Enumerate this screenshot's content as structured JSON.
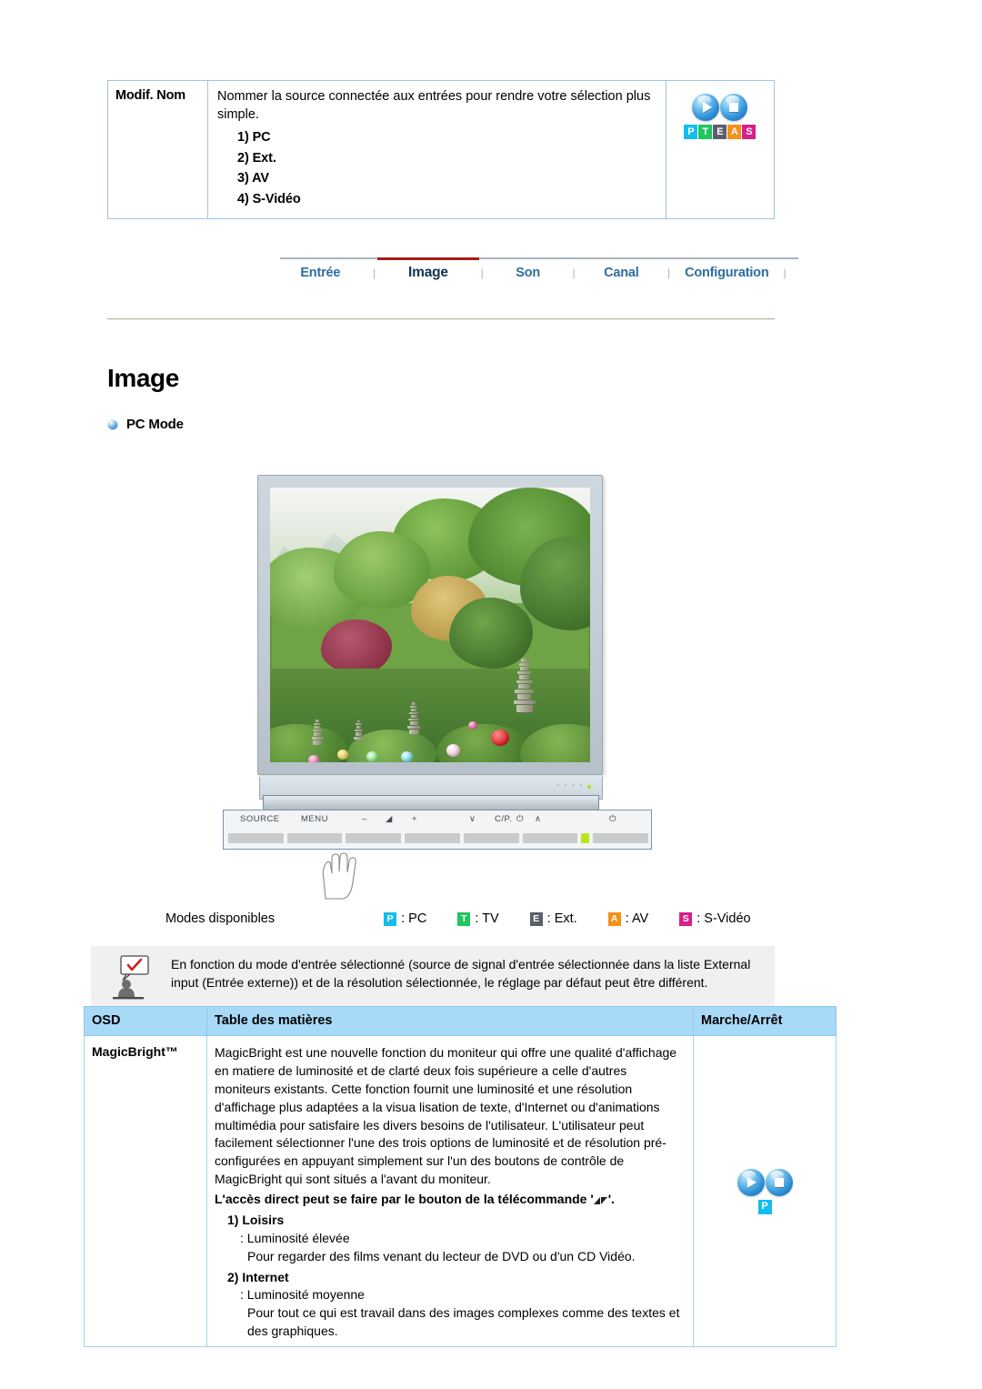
{
  "modif_table": {
    "label": "Modif. Nom",
    "description": "Nommer la source connectée aux entrées pour rendre votre sélection plus simple.",
    "options": [
      "1) PC",
      "2) Ext.",
      "3) AV",
      "4) S-Vidéo"
    ],
    "icon_badges": [
      {
        "letter": "P",
        "color": "#15bdee"
      },
      {
        "letter": "T",
        "color": "#22c55e"
      },
      {
        "letter": "E",
        "color": "#5b5f6b"
      },
      {
        "letter": "A",
        "color": "#f59019"
      },
      {
        "letter": "S",
        "color": "#d6208a"
      }
    ]
  },
  "nav": {
    "items": [
      {
        "label": "Entrée",
        "active": false
      },
      {
        "label": "Image",
        "active": true
      },
      {
        "label": "Son",
        "active": false
      },
      {
        "label": "Canal",
        "active": false
      },
      {
        "label": "Configuration",
        "active": false
      }
    ],
    "separator": "|",
    "active_color": "#12344f",
    "inactive_color": "#2d6e9e",
    "active_bar_color": "#a81b1b"
  },
  "page": {
    "title": "Image",
    "section_bullet": "PC Mode"
  },
  "monitor": {
    "controls": [
      {
        "label": "SOURCE"
      },
      {
        "label": "MENU"
      },
      {
        "label": "–"
      },
      {
        "label": "volume-icon"
      },
      {
        "label": "+"
      },
      {
        "label": "∨"
      },
      {
        "label": "C/P.⏻"
      },
      {
        "label": "∧"
      },
      {
        "label": "power-icon"
      }
    ],
    "control_labels": [
      "SOURCE",
      "MENU",
      "–",
      "+",
      "∨",
      "C/P.",
      "∧"
    ],
    "led_color": "#b8e61e"
  },
  "modes": {
    "label": "Modes disponibles",
    "items": [
      {
        "letter": "P",
        "color": "#15bdee",
        "text": ": PC"
      },
      {
        "letter": "T",
        "color": "#22c55e",
        "text": ": TV"
      },
      {
        "letter": "E",
        "color": "#5b5f6b",
        "text": ": Ext."
      },
      {
        "letter": "A",
        "color": "#f59019",
        "text": ": AV"
      },
      {
        "letter": "S",
        "color": "#d6208a",
        "text": ": S-Vidéo"
      }
    ]
  },
  "note": {
    "text": "En fonction du mode d'entrée sélectionné (source de signal d'entrée sélectionnée dans la liste External input (Entrée externe)) et de la résolution sélectionnée, le réglage par défaut peut être différent.",
    "background": "#f0f0f0"
  },
  "osd_table": {
    "headers": [
      "OSD",
      "Table des matières",
      "Marche/Arrêt"
    ],
    "header_bg": "#a8daf7",
    "border_color": "#9fd3ef",
    "rows": [
      {
        "osd": "MagicBright™",
        "paragraph": "MagicBright est une nouvelle fonction du moniteur qui offre une qualité d'affichage en matiere de luminosité et de clarté deux fois supérieure a celle d'autres moniteurs existants. Cette fonction fournit une luminosité et une résolution d'affichage plus adaptées a la visua lisation de texte, d'Internet ou d'animations multimédia pour satisfaire les divers besoins de l'utilisateur. L'utilisateur peut facilement sélectionner l'une des trois options de luminosité et de résolution pré-configurées en appuyant simplement sur l'un des boutons de contrôle de MagicBright qui sont situés a l'avant du moniteur.",
        "access_line_prefix": "L'accès direct peut se faire par le bouton de la télécommande '",
        "access_line_suffix": "'.",
        "items": [
          {
            "num": "1) Loisirs",
            "value": ": Luminosité élevée",
            "detail": "Pour regarder des films venant du lecteur de DVD ou d'un CD Vidéo."
          },
          {
            "num": "2) Internet",
            "value": ": Luminosité moyenne",
            "detail": "Pour tout ce qui est travail dans des images complexes comme des textes et des graphiques."
          }
        ],
        "power_badge": {
          "letter": "P",
          "color": "#15bdee"
        }
      }
    ]
  }
}
